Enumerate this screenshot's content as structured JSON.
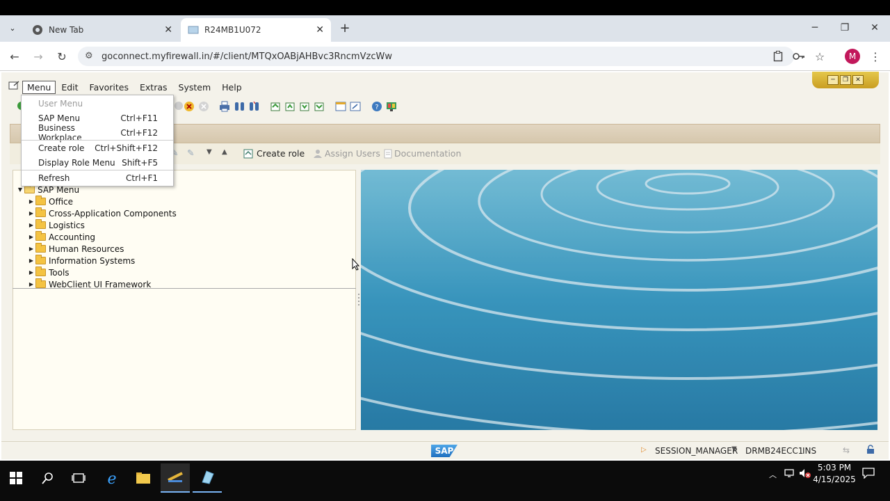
{
  "browser": {
    "tabs": [
      {
        "label": "New Tab"
      },
      {
        "label": "R24MB1U072"
      }
    ],
    "url": "goconnect.myfirewall.in/#/client/MTQxOABjAHBvc3RncmVzcWw",
    "profile_initial": "M"
  },
  "sap": {
    "menubar": [
      "Menu",
      "Edit",
      "Favorites",
      "Extras",
      "System",
      "Help"
    ],
    "app_toolbar": {
      "create_role": "Create role",
      "assign_users": "Assign Users",
      "documentation": "Documentation"
    },
    "dropdown": [
      {
        "label": "User Menu",
        "shortcut": ""
      },
      {
        "label": "SAP Menu",
        "shortcut": "Ctrl+F11"
      },
      {
        "label": "Business Workplace",
        "shortcut": "Ctrl+F12"
      },
      {
        "label": "Create role",
        "shortcut": "Ctrl+Shift+F12"
      },
      {
        "label": "Display Role Menu",
        "shortcut": "Shift+F5"
      },
      {
        "label": "Refresh",
        "shortcut": "Ctrl+F1"
      }
    ],
    "tree": {
      "root": "SAP Menu",
      "items": [
        "Office",
        "Cross-Application Components",
        "Logistics",
        "Accounting",
        "Human Resources",
        "Information Systems",
        "Tools",
        "WebClient UI Framework"
      ]
    },
    "status": {
      "logo": "SAP",
      "session": "SESSION_MANAGER",
      "system": "DRMB24ECC1",
      "mode": "INS"
    }
  },
  "taskbar": {
    "time": "5:03 PM",
    "date": "4/15/2025"
  }
}
